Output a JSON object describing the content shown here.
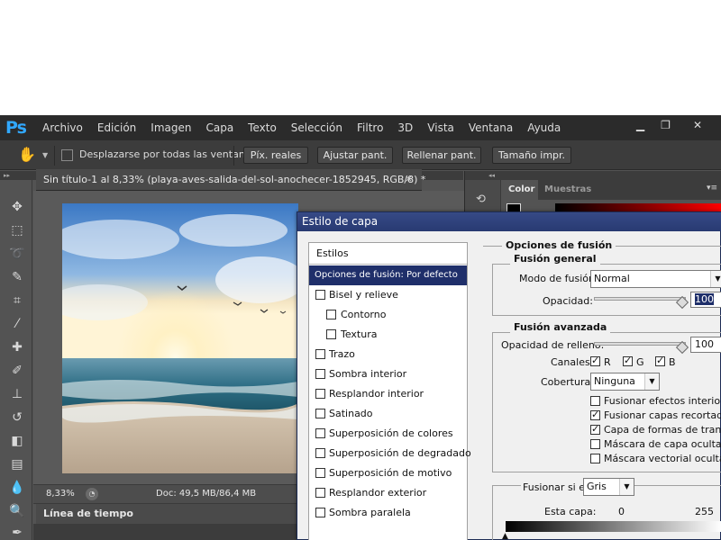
{
  "app": {
    "logo": "Ps",
    "menu": [
      "Archivo",
      "Edición",
      "Imagen",
      "Capa",
      "Texto",
      "Selección",
      "Filtro",
      "3D",
      "Vista",
      "Ventana",
      "Ayuda"
    ],
    "window_controls": {
      "minimize": "▁",
      "maximize": "❐",
      "close": "✕"
    }
  },
  "options_bar": {
    "scroll_all_label": "Desplazarse por todas las ventanas",
    "scroll_all_checked": false,
    "buttons": [
      "Píx. reales",
      "Ajustar pant.",
      "Rellenar pant.",
      "Tamaño impr."
    ]
  },
  "document": {
    "tab_title": "Sin título-1 al 8,33% (playa-aves-salida-del-sol-anochecer-1852945, RGB/8) *",
    "tab_close": "×",
    "zoom": "8,33%",
    "doc_size": "Doc: 49,5 MB/86,4 MB"
  },
  "timeline": {
    "label": "Línea de tiempo"
  },
  "tools": [
    "move-tool",
    "marquee-tool",
    "lasso-tool",
    "quick-selection-tool",
    "crop-tool",
    "eyedropper-tool",
    "healing-brush-tool",
    "brush-tool",
    "clone-stamp-tool",
    "history-brush-tool",
    "eraser-tool",
    "gradient-tool",
    "blur-tool",
    "dodge-tool",
    "pen-tool"
  ],
  "right_panel": {
    "tabs": [
      "Color",
      "Muestras"
    ],
    "active_tab": "Color"
  },
  "dialog": {
    "title": "Estilo de capa",
    "styles_header": "Estilos",
    "styles": [
      {
        "label": "Opciones de fusión: Por defecto",
        "selected": true,
        "checkbox": false
      },
      {
        "label": "Bisel y relieve",
        "checked": false,
        "checkbox": true,
        "indent": false
      },
      {
        "label": "Contorno",
        "checked": false,
        "checkbox": true,
        "indent": true
      },
      {
        "label": "Textura",
        "checked": false,
        "checkbox": true,
        "indent": true
      },
      {
        "label": "Trazo",
        "checked": false,
        "checkbox": true,
        "indent": false
      },
      {
        "label": "Sombra interior",
        "checked": false,
        "checkbox": true,
        "indent": false
      },
      {
        "label": "Resplandor interior",
        "checked": false,
        "checkbox": true,
        "indent": false
      },
      {
        "label": "Satinado",
        "checked": false,
        "checkbox": true,
        "indent": false
      },
      {
        "label": "Superposición de colores",
        "checked": false,
        "checkbox": true,
        "indent": false
      },
      {
        "label": "Superposición de degradado",
        "checked": false,
        "checkbox": true,
        "indent": false
      },
      {
        "label": "Superposición de motivo",
        "checked": false,
        "checkbox": true,
        "indent": false
      },
      {
        "label": "Resplandor exterior",
        "checked": false,
        "checkbox": true,
        "indent": false
      },
      {
        "label": "Sombra paralela",
        "checked": false,
        "checkbox": true,
        "indent": false
      }
    ],
    "blending_options_title": "Opciones de fusión",
    "general": {
      "title": "Fusión general",
      "mode_label": "Modo de fusión:",
      "mode_value": "Normal",
      "opacity_label": "Opacidad:",
      "opacity_value": "100",
      "opacity_level": 1.0
    },
    "advanced": {
      "title": "Fusión avanzada",
      "fill_opacity_label": "Opacidad de relleno:",
      "fill_opacity_value": "100",
      "fill_opacity_level": 1.0,
      "channels_label": "Canales:",
      "channels": [
        {
          "name": "R",
          "checked": true
        },
        {
          "name": "G",
          "checked": true
        },
        {
          "name": "B",
          "checked": true
        }
      ],
      "knockout_label": "Cobertura:",
      "knockout_value": "Ninguna",
      "options": [
        {
          "label": "Fusionar efectos interiores co",
          "checked": false
        },
        {
          "label": "Fusionar capas recortadas co",
          "checked": true
        },
        {
          "label": "Capa de formas de transparer",
          "checked": true
        },
        {
          "label": "Máscara de capa oculta efecto",
          "checked": false
        },
        {
          "label": "Máscara vectorial oculta efec",
          "checked": false
        }
      ]
    },
    "blend_if": {
      "label": "Fusionar si es:",
      "value": "Gris",
      "this_layer_label": "Esta capa:",
      "min": "0",
      "max": "255"
    }
  }
}
